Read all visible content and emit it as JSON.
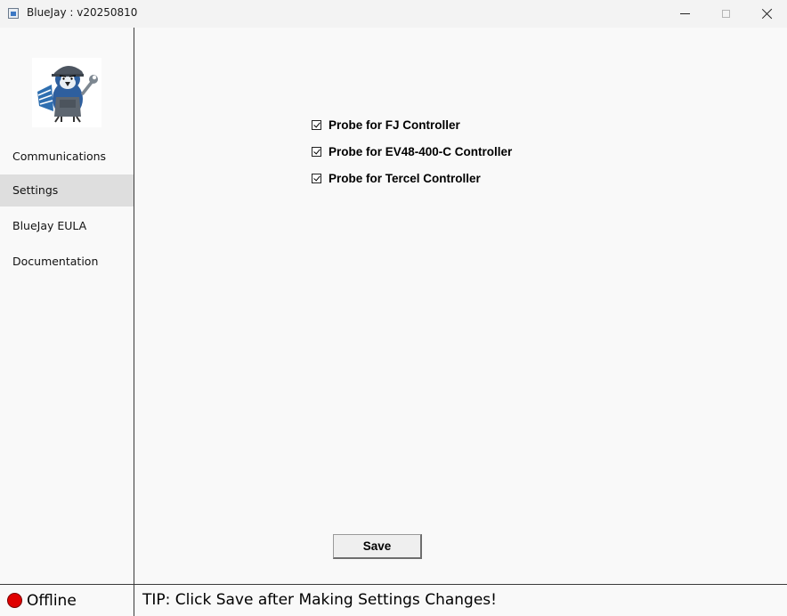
{
  "window": {
    "title": "BlueJay : v20250810",
    "icon": "app-window-icon",
    "controls": [
      "minimize",
      "maximize",
      "close"
    ]
  },
  "sidebar": {
    "logo": "bluejay-mechanic-logo",
    "items": [
      {
        "label": "Communications",
        "active": false
      },
      {
        "label": "Settings",
        "active": true
      },
      {
        "label": "BlueJay EULA",
        "active": false
      },
      {
        "label": "Documentation",
        "active": false
      }
    ]
  },
  "settings": {
    "options": [
      {
        "label": "Probe for FJ Controller",
        "checked": true
      },
      {
        "label": "Probe for EV48-400-C Controller",
        "checked": true
      },
      {
        "label": "Probe for Tercel Controller",
        "checked": true
      }
    ],
    "save_label": "Save"
  },
  "status": {
    "text": "Offline",
    "color": "#e00000"
  },
  "tip": "TIP: Click Save after Making Settings Changes!"
}
